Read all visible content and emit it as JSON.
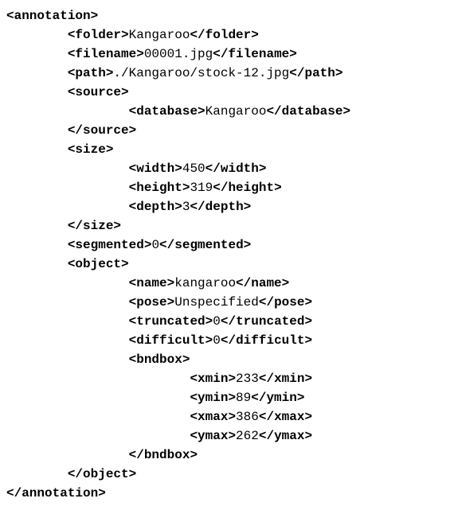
{
  "tags": {
    "annotation_open": "<annotation>",
    "annotation_close": "</annotation>",
    "folder_open": "<folder>",
    "folder_close": "</folder>",
    "filename_open": "<filename>",
    "filename_close": "</filename>",
    "path_open": "<path>",
    "path_close": "</path>",
    "source_open": "<source>",
    "source_close": "</source>",
    "database_open": "<database>",
    "database_close": "</database>",
    "size_open": "<size>",
    "size_close": "</size>",
    "width_open": "<width>",
    "width_close": "</width>",
    "height_open": "<height>",
    "height_close": "</height>",
    "depth_open": "<depth>",
    "depth_close": "</depth>",
    "segmented_open": "<segmented>",
    "segmented_close": "</segmented>",
    "object_open": "<object>",
    "object_close": "</object>",
    "name_open": "<name>",
    "name_close": "</name>",
    "pose_open": "<pose>",
    "pose_close": "</pose>",
    "truncated_open": "<truncated>",
    "truncated_close": "</truncated>",
    "difficult_open": "<difficult>",
    "difficult_close": "</difficult>",
    "bndbox_open": "<bndbox>",
    "bndbox_close": "</bndbox>",
    "xmin_open": "<xmin>",
    "xmin_close": "</xmin>",
    "ymin_open": "<ymin>",
    "ymin_close": "</ymin>",
    "xmax_open": "<xmax>",
    "xmax_close": "</xmax>",
    "ymax_open": "<ymax>",
    "ymax_close": "</ymax>"
  },
  "values": {
    "folder": "Kangaroo",
    "filename": "00001.jpg",
    "path": "./Kangaroo/stock-12.jpg",
    "database": "Kangaroo",
    "width": "450",
    "height": "319",
    "depth": "3",
    "segmented": "0",
    "name": "kangaroo",
    "pose": "Unspecified",
    "truncated": "0",
    "difficult": "0",
    "xmin": "233",
    "ymin": "89",
    "xmax": "386",
    "ymax": "262"
  }
}
